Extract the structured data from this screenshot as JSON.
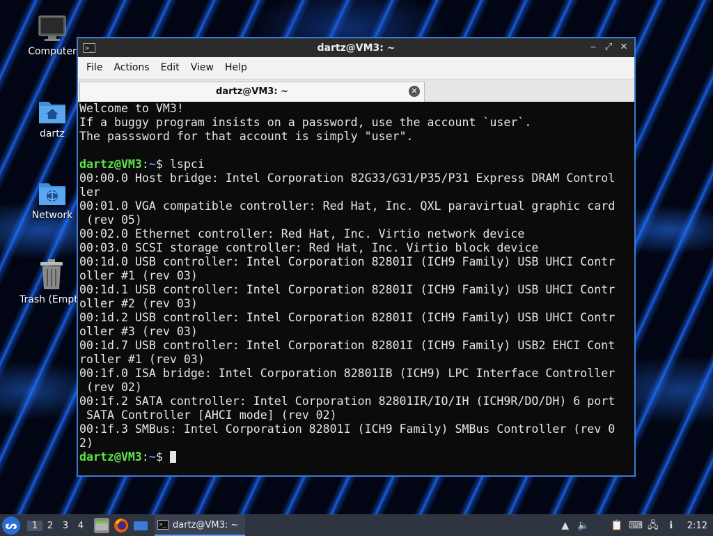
{
  "desktop": {
    "icons": [
      {
        "label": "Computer",
        "icon": "monitor-icon"
      },
      {
        "label": "dartz",
        "icon": "home-folder-icon"
      },
      {
        "label": "Network",
        "icon": "network-folder-icon"
      },
      {
        "label": "Trash (Empt",
        "icon": "trash-icon"
      }
    ]
  },
  "window": {
    "title": "dartz@VM3: ~",
    "controls": {
      "minimize": "‒",
      "maximize": "⤢",
      "close": "✕"
    },
    "menu": [
      "File",
      "Actions",
      "Edit",
      "View",
      "Help"
    ],
    "tab": {
      "label": "dartz@VM3: ~",
      "close": "✕"
    }
  },
  "terminal": {
    "prompt_user": "dartz@VM3",
    "prompt_sep": ":",
    "prompt_path": "~",
    "prompt_dollar": "$ ",
    "command": "lspci",
    "welcome": [
      "Welcome to VM3!",
      "If a buggy program insists on a password, use the account `user`.",
      "The passsword for that account is simply \"user\"."
    ],
    "output": [
      "00:00.0 Host bridge: Intel Corporation 82G33/G31/P35/P31 Express DRAM Control",
      "ler",
      "00:01.0 VGA compatible controller: Red Hat, Inc. QXL paravirtual graphic card",
      " (rev 05)",
      "00:02.0 Ethernet controller: Red Hat, Inc. Virtio network device",
      "00:03.0 SCSI storage controller: Red Hat, Inc. Virtio block device",
      "00:1d.0 USB controller: Intel Corporation 82801I (ICH9 Family) USB UHCI Contr",
      "oller #1 (rev 03)",
      "00:1d.1 USB controller: Intel Corporation 82801I (ICH9 Family) USB UHCI Contr",
      "oller #2 (rev 03)",
      "00:1d.2 USB controller: Intel Corporation 82801I (ICH9 Family) USB UHCI Contr",
      "oller #3 (rev 03)",
      "00:1d.7 USB controller: Intel Corporation 82801I (ICH9 Family) USB2 EHCI Cont",
      "roller #1 (rev 03)",
      "00:1f.0 ISA bridge: Intel Corporation 82801IB (ICH9) LPC Interface Controller",
      " (rev 02)",
      "00:1f.2 SATA controller: Intel Corporation 82801IR/IO/IH (ICH9R/DO/DH) 6 port",
      " SATA Controller [AHCI mode] (rev 02)",
      "00:1f.3 SMBus: Intel Corporation 82801I (ICH9 Family) SMBus Controller (rev 0",
      "2)"
    ]
  },
  "taskbar": {
    "start_icon": "lubuntu-logo-icon",
    "workspaces": [
      "1",
      "2",
      "3",
      "4"
    ],
    "active_workspace": "1",
    "task_label": "dartz@VM3: ~",
    "clock": "2:12",
    "colors": {
      "accent": "#3a7bd5",
      "prompt_user": "#5ee54a",
      "prompt_path": "#5aa0ff"
    }
  }
}
